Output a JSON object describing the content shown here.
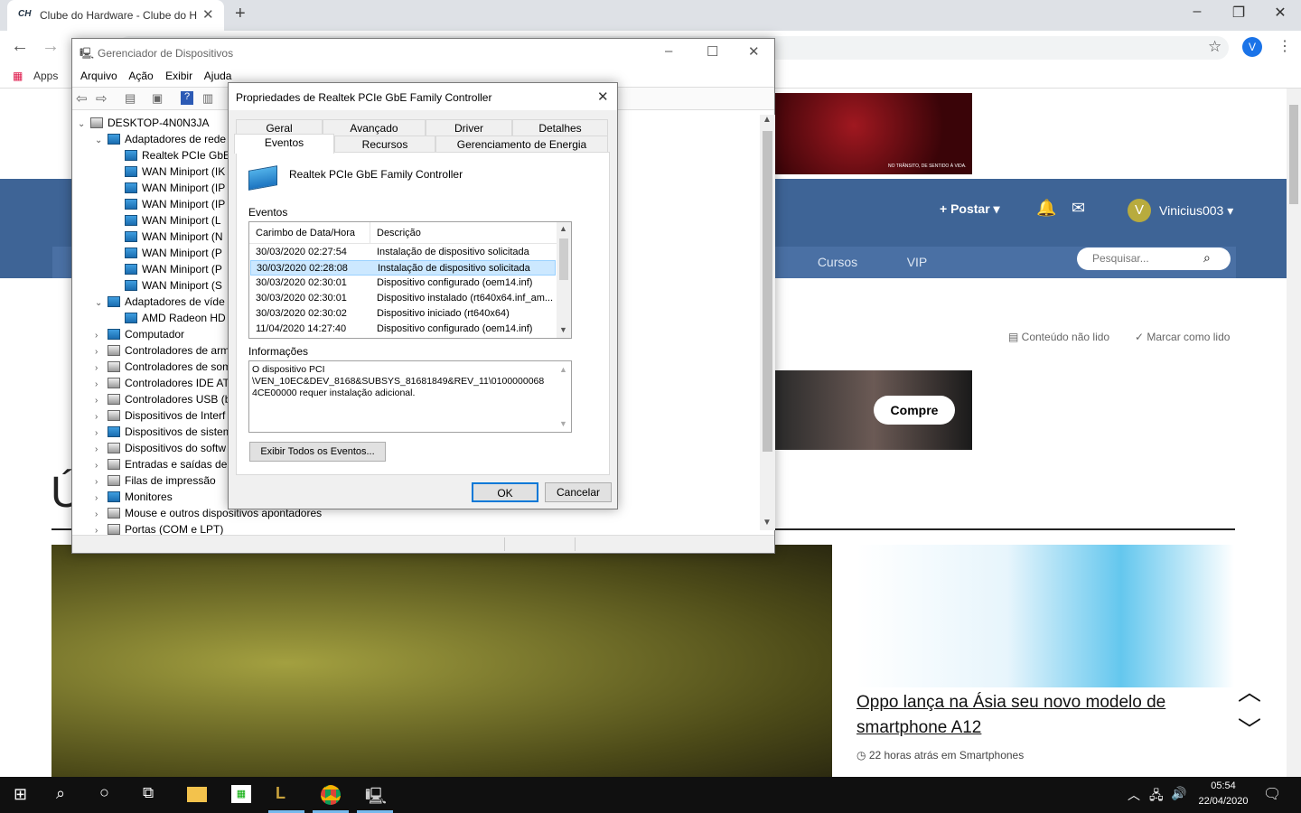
{
  "browser": {
    "tab_title": "Clube do Hardware - Clube do H",
    "tab_favicon": "CH",
    "bookmarks_apps": "Apps",
    "profile_initial": "V"
  },
  "site": {
    "user": "Vinicius003",
    "post_label": "Postar",
    "nav": [
      "Cursos",
      "VIP"
    ],
    "search_placeholder": "Pesquisar...",
    "unread": "Conteúdo não lido",
    "mark_read": "Marcar como lido",
    "ad_button": "Compre",
    "ad_small_text": "NO TRÂNSITO, DE SENTIDO À VIDA.",
    "article_title": "Oppo lança na Ásia seu novo modelo de smartphone A12",
    "article_meta": "22 horas atrás em Smartphones",
    "big_letter": "Ú"
  },
  "devmgr": {
    "title": "Gerenciador de Dispositivos",
    "menu": [
      "Arquivo",
      "Ação",
      "Exibir",
      "Ajuda"
    ],
    "tree": [
      {
        "label": "DESKTOP-4N0N3JA",
        "level": 0,
        "exp": "⌄",
        "icon": "computer"
      },
      {
        "label": "Adaptadores de rede",
        "level": 1,
        "exp": "⌄",
        "icon": "net"
      },
      {
        "label": "Realtek PCIe GbE",
        "level": 2,
        "exp": "",
        "icon": "net"
      },
      {
        "label": "WAN Miniport (IK",
        "level": 2,
        "exp": "",
        "icon": "net"
      },
      {
        "label": "WAN Miniport (IP",
        "level": 2,
        "exp": "",
        "icon": "net"
      },
      {
        "label": "WAN Miniport (IP",
        "level": 2,
        "exp": "",
        "icon": "net"
      },
      {
        "label": "WAN Miniport (L",
        "level": 2,
        "exp": "",
        "icon": "net"
      },
      {
        "label": "WAN Miniport (N",
        "level": 2,
        "exp": "",
        "icon": "net"
      },
      {
        "label": "WAN Miniport (P",
        "level": 2,
        "exp": "",
        "icon": "net"
      },
      {
        "label": "WAN Miniport (P",
        "level": 2,
        "exp": "",
        "icon": "net"
      },
      {
        "label": "WAN Miniport (S",
        "level": 2,
        "exp": "",
        "icon": "net"
      },
      {
        "label": "Adaptadores de víde",
        "level": 1,
        "exp": "⌄",
        "icon": "display"
      },
      {
        "label": "AMD Radeon HD",
        "level": 2,
        "exp": "",
        "icon": "display"
      },
      {
        "label": "Computador",
        "level": 1,
        "exp": "›",
        "icon": "display"
      },
      {
        "label": "Controladores de arm",
        "level": 1,
        "exp": "›",
        "icon": "generic"
      },
      {
        "label": "Controladores de som",
        "level": 1,
        "exp": "›",
        "icon": "generic"
      },
      {
        "label": "Controladores IDE AT",
        "level": 1,
        "exp": "›",
        "icon": "generic"
      },
      {
        "label": "Controladores USB (b",
        "level": 1,
        "exp": "›",
        "icon": "generic"
      },
      {
        "label": "Dispositivos de Interf",
        "level": 1,
        "exp": "›",
        "icon": "generic"
      },
      {
        "label": "Dispositivos de sistem",
        "level": 1,
        "exp": "›",
        "icon": "display"
      },
      {
        "label": "Dispositivos do softw",
        "level": 1,
        "exp": "›",
        "icon": "generic"
      },
      {
        "label": "Entradas e saídas de",
        "level": 1,
        "exp": "›",
        "icon": "generic"
      },
      {
        "label": "Filas de impressão",
        "level": 1,
        "exp": "›",
        "icon": "generic"
      },
      {
        "label": "Monitores",
        "level": 1,
        "exp": "›",
        "icon": "display"
      },
      {
        "label": "Mouse e outros dispositivos apontadores",
        "level": 1,
        "exp": "›",
        "icon": "generic"
      },
      {
        "label": "Portas (COM e LPT)",
        "level": 1,
        "exp": "›",
        "icon": "generic"
      }
    ]
  },
  "dialog": {
    "title": "Propriedades de Realtek PCIe GbE Family Controller",
    "tabs_top": [
      "Geral",
      "Avançado",
      "Driver",
      "Detalhes"
    ],
    "tabs_bottom": [
      "Eventos",
      "Recursos",
      "Gerenciamento de Energia"
    ],
    "device_name": "Realtek PCIe GbE Family Controller",
    "events_label": "Eventos",
    "col_time": "Carimbo de Data/Hora",
    "col_desc": "Descrição",
    "events": [
      {
        "time": "30/03/2020 02:27:54",
        "desc": "Instalação de dispositivo solicitada"
      },
      {
        "time": "30/03/2020 02:28:08",
        "desc": "Instalação de dispositivo solicitada"
      },
      {
        "time": "30/03/2020 02:30:01",
        "desc": "Dispositivo configurado (oem14.inf)"
      },
      {
        "time": "30/03/2020 02:30:01",
        "desc": "Dispositivo instalado (rt640x64.inf_am..."
      },
      {
        "time": "30/03/2020 02:30:02",
        "desc": "Dispositivo iniciado (rt640x64)"
      },
      {
        "time": "11/04/2020 14:27:40",
        "desc": "Dispositivo configurado (oem14.inf)"
      }
    ],
    "selected_event": 1,
    "info_label": "Informações",
    "info_text": "O dispositivo PCI\n\\VEN_10EC&DEV_8168&SUBSYS_81681849&REV_11\\0100000068\n4CE00000 requer instalação adicional.",
    "show_all": "Exibir Todos os Eventos...",
    "ok": "OK",
    "cancel": "Cancelar"
  },
  "taskbar": {
    "time": "05:54",
    "date": "22/04/2020"
  }
}
